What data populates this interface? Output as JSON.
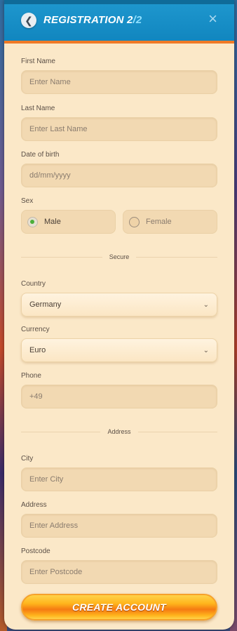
{
  "header": {
    "title": "REGISTRATION 2",
    "step": "/2",
    "close": "×"
  },
  "fields": {
    "first_name": {
      "label": "First Name",
      "placeholder": "Enter Name"
    },
    "last_name": {
      "label": "Last Name",
      "placeholder": "Enter Last Name"
    },
    "dob": {
      "label": "Date of birth",
      "placeholder": "dd/mm/yyyy"
    },
    "sex": {
      "label": "Sex",
      "male": "Male",
      "female": "Female",
      "selected": "Male"
    },
    "secure_divider": "Secure",
    "country": {
      "label": "Country",
      "value": "Germany"
    },
    "currency": {
      "label": "Currency",
      "value": "Euro"
    },
    "phone": {
      "label": "Phone",
      "value": "+49"
    },
    "address_divider": "Address",
    "city": {
      "label": "City",
      "placeholder": "Enter City"
    },
    "address": {
      "label": "Address",
      "placeholder": "Enter Address"
    },
    "postcode": {
      "label": "Postcode",
      "placeholder": "Enter Postcode"
    }
  },
  "submit": {
    "label": "CREATE ACCOUNT"
  },
  "colors": {
    "header": "#1a8fc8",
    "accent": "#f07a26",
    "panel": "#fbe8c8",
    "button": "#ffb51c"
  }
}
